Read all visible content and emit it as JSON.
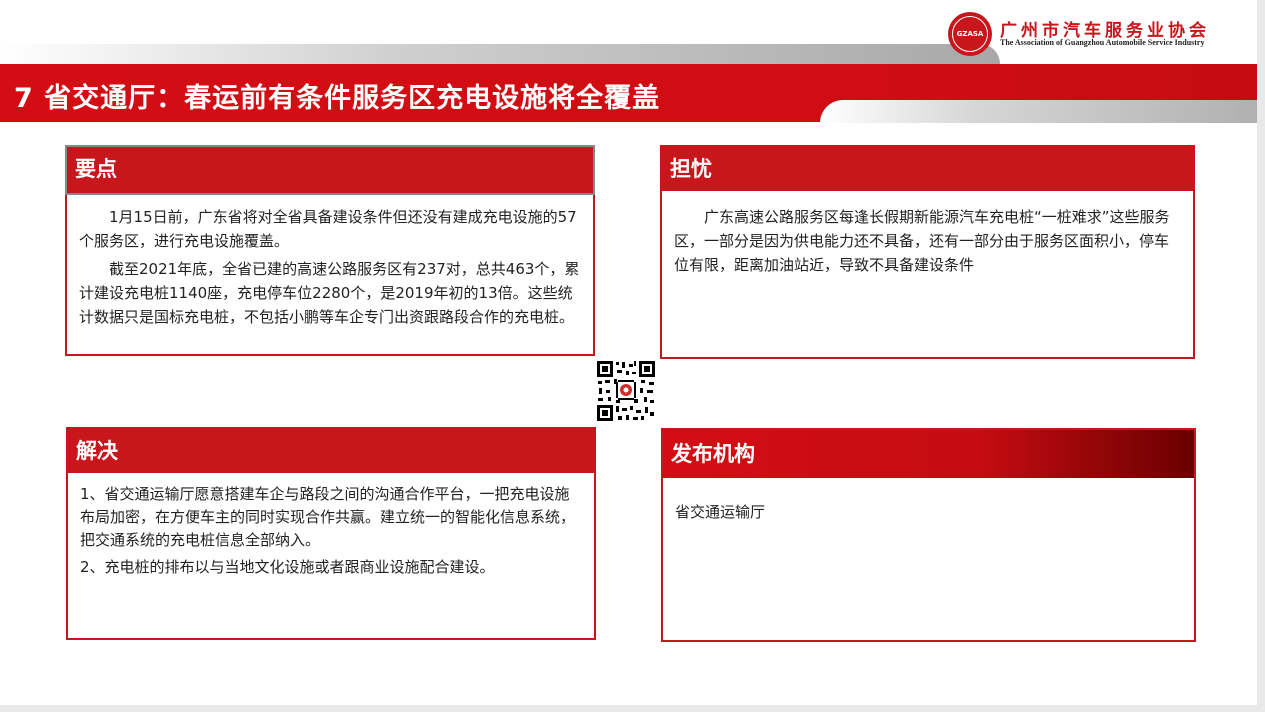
{
  "header": {
    "title": "7  省交通厅：春运前有条件服务区充电设施将全覆盖",
    "org_cn": "广州市汽车服务业协会",
    "org_en": "The Association of Guangzhou Automobile Service Industry",
    "seal_text": "GZASA"
  },
  "cards": {
    "points": {
      "heading": "要点",
      "paragraphs": [
        "1月15日前，广东省将对全省具备建设条件但还没有建成充电设施的57个服务区，进行充电设施覆盖。",
        "截至2021年底，全省已建的高速公路服务区有237对，总共463个，累计建设充电桩1140座，充电停车位2280个，是2019年初的13倍。这些统计数据只是国标充电桩，不包括小鹏等车企专门出资跟路段合作的充电桩。"
      ]
    },
    "concern": {
      "heading": "担忧",
      "paragraphs": [
        "广东高速公路服务区每逢长假期新能源汽车充电桩“一桩难求”这些服务区，一部分是因为供电能力还不具备，还有一部分由于服务区面积小，停车位有限，距离加油站近，导致不具备建设条件"
      ]
    },
    "solution": {
      "heading": "解决",
      "paragraphs": [
        "1、省交通运输厅愿意搭建车企与路段之间的沟通合作平台，一把充电设施布局加密，在方便车主的同时实现合作共赢。建立统一的智能化信息系统，把交通系统的充电桩信息全部纳入。",
        "2、充电桩的排布以与当地文化设施或者跟商业设施配合建设。"
      ]
    },
    "publisher": {
      "heading": "发布机构",
      "paragraphs": [
        "省交通运输厅"
      ]
    }
  },
  "colors": {
    "accent": "#c8161d",
    "dark_red": "#6a0000",
    "qr_dot": "#d42b2b"
  },
  "icons": {
    "logo": "association-seal-icon",
    "qr": "qr-code-icon"
  }
}
